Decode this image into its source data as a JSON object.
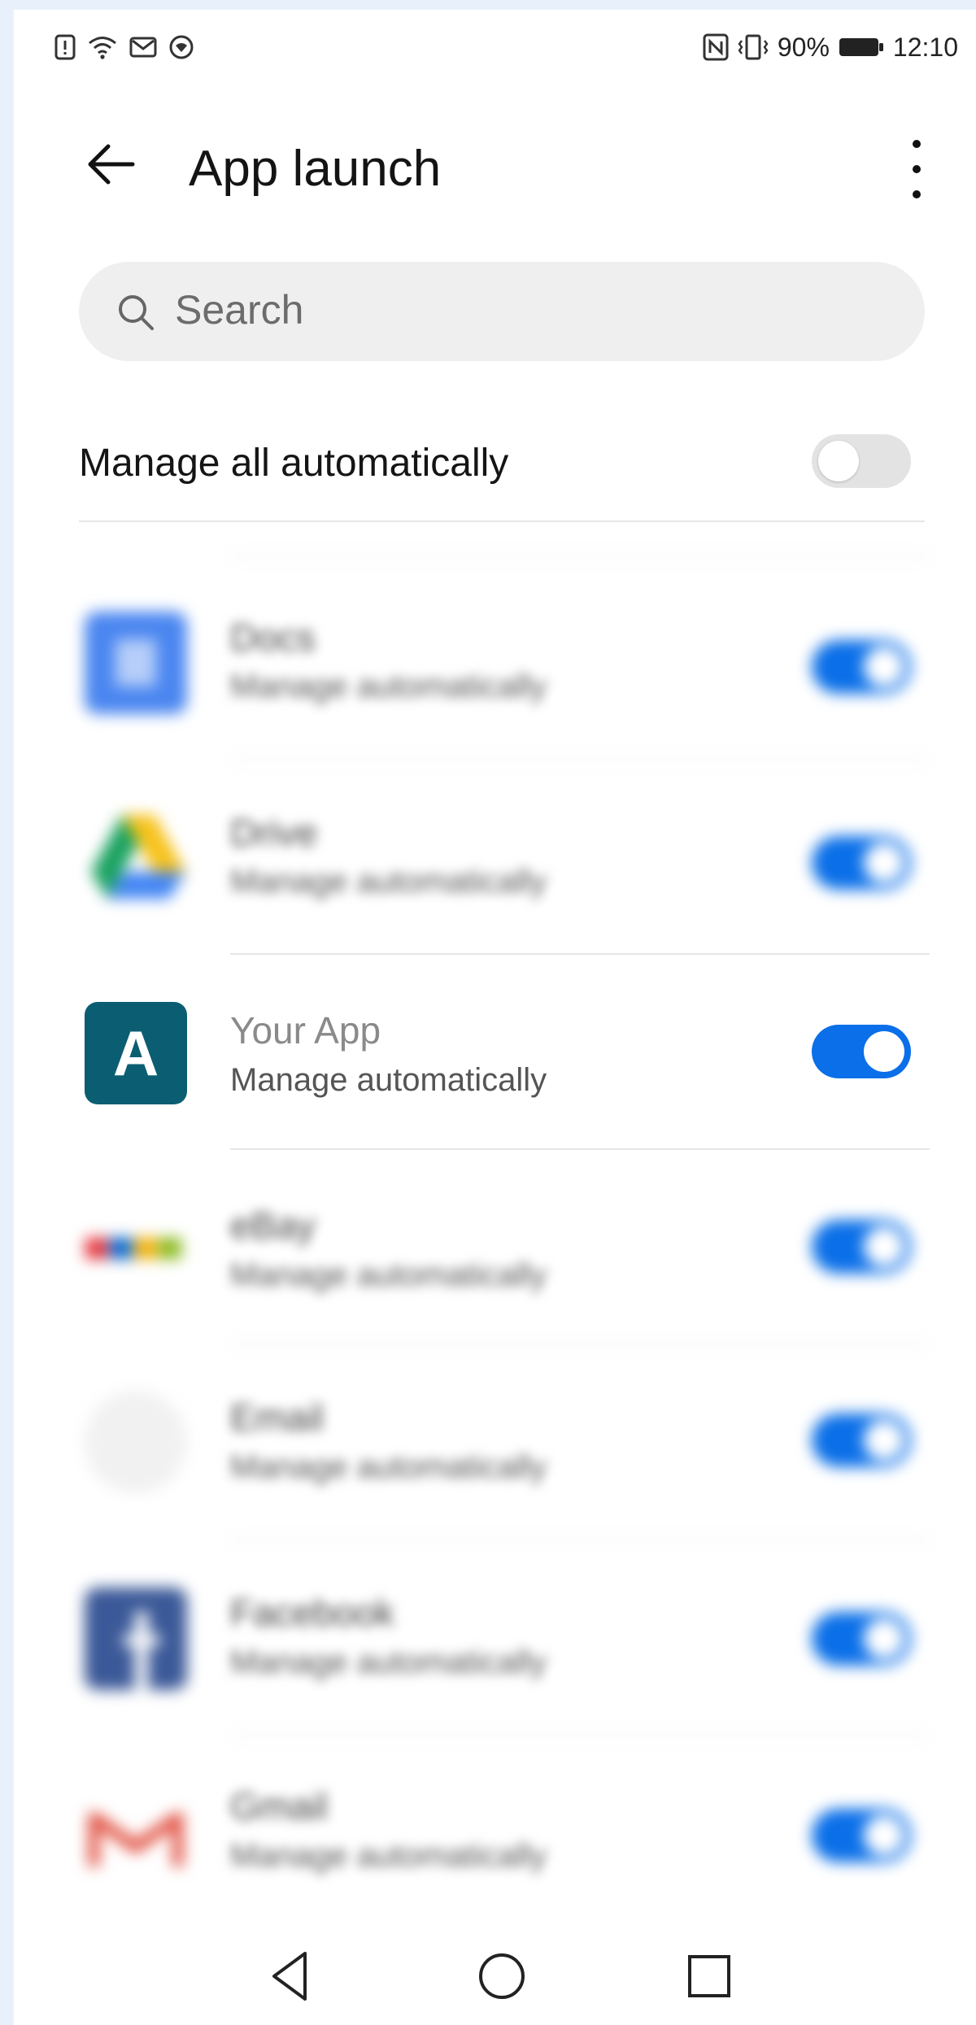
{
  "status_bar": {
    "left_icons": [
      "alert-icon",
      "wifi-icon",
      "mail-icon",
      "app-icon"
    ],
    "right_icons": [
      "nfc-icon",
      "vibrate-icon"
    ],
    "battery": "90%",
    "time": "12:10"
  },
  "header": {
    "title": "App launch",
    "back_icon": "arrow-left-icon",
    "menu_icon": "more-vert-icon"
  },
  "search": {
    "placeholder": "Search",
    "icon": "search-icon"
  },
  "manage_all": {
    "label": "Manage all automatically",
    "enabled": false
  },
  "apps": [
    {
      "name": "Docs",
      "subtitle": "Manage automatically",
      "enabled": true,
      "blurred": true,
      "icon": "docs-icon",
      "icon_color": "#4a86f0"
    },
    {
      "name": "Drive",
      "subtitle": "Manage automatically",
      "enabled": true,
      "blurred": true,
      "icon": "drive-icon"
    },
    {
      "name": "Your App",
      "subtitle": "Manage automatically",
      "enabled": true,
      "blurred": false,
      "icon": "app-letter-icon",
      "icon_letter": "A",
      "icon_color": "#0b5e72"
    },
    {
      "name": "eBay",
      "subtitle": "Manage automatically",
      "enabled": true,
      "blurred": true,
      "icon": "ebay-icon"
    },
    {
      "name": "Email",
      "subtitle": "Manage automatically",
      "enabled": true,
      "blurred": true,
      "icon": "email-icon"
    },
    {
      "name": "Facebook",
      "subtitle": "Manage automatically",
      "enabled": true,
      "blurred": true,
      "icon": "facebook-icon",
      "icon_color": "#3b5998"
    },
    {
      "name": "Gmail",
      "subtitle": "Manage automatically",
      "enabled": true,
      "blurred": true,
      "icon": "gmail-icon",
      "icon_color": "#e04a3a"
    }
  ],
  "nav_bar": [
    "back-nav-icon",
    "home-nav-icon",
    "recents-nav-icon"
  ],
  "colors": {
    "accent": "#0a6fe8",
    "your_app_icon": "#0b5e72"
  }
}
